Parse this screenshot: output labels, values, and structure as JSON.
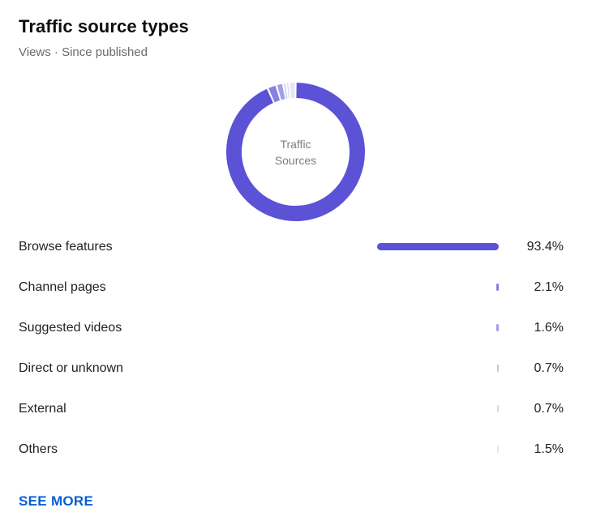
{
  "header": {
    "title": "Traffic source types",
    "subtitle": "Views · Since published"
  },
  "donut": {
    "center_line1": "Traffic",
    "center_line2": "Sources"
  },
  "chart_data": {
    "type": "pie",
    "donut": true,
    "categories": [
      "Browse features",
      "Channel pages",
      "Suggested videos",
      "Direct or unknown",
      "External",
      "Others"
    ],
    "values": [
      93.4,
      2.1,
      1.6,
      0.7,
      0.7,
      1.5
    ],
    "labels": [
      "93.4%",
      "2.1%",
      "1.6%",
      "0.7%",
      "0.7%",
      "1.5%"
    ],
    "colors": [
      "#5b52d6",
      "#8680e0",
      "#a39ee8",
      "#c2bff0",
      "#d6d4f4",
      "#e6e5f8"
    ]
  },
  "actions": {
    "see_more": "SEE MORE"
  }
}
